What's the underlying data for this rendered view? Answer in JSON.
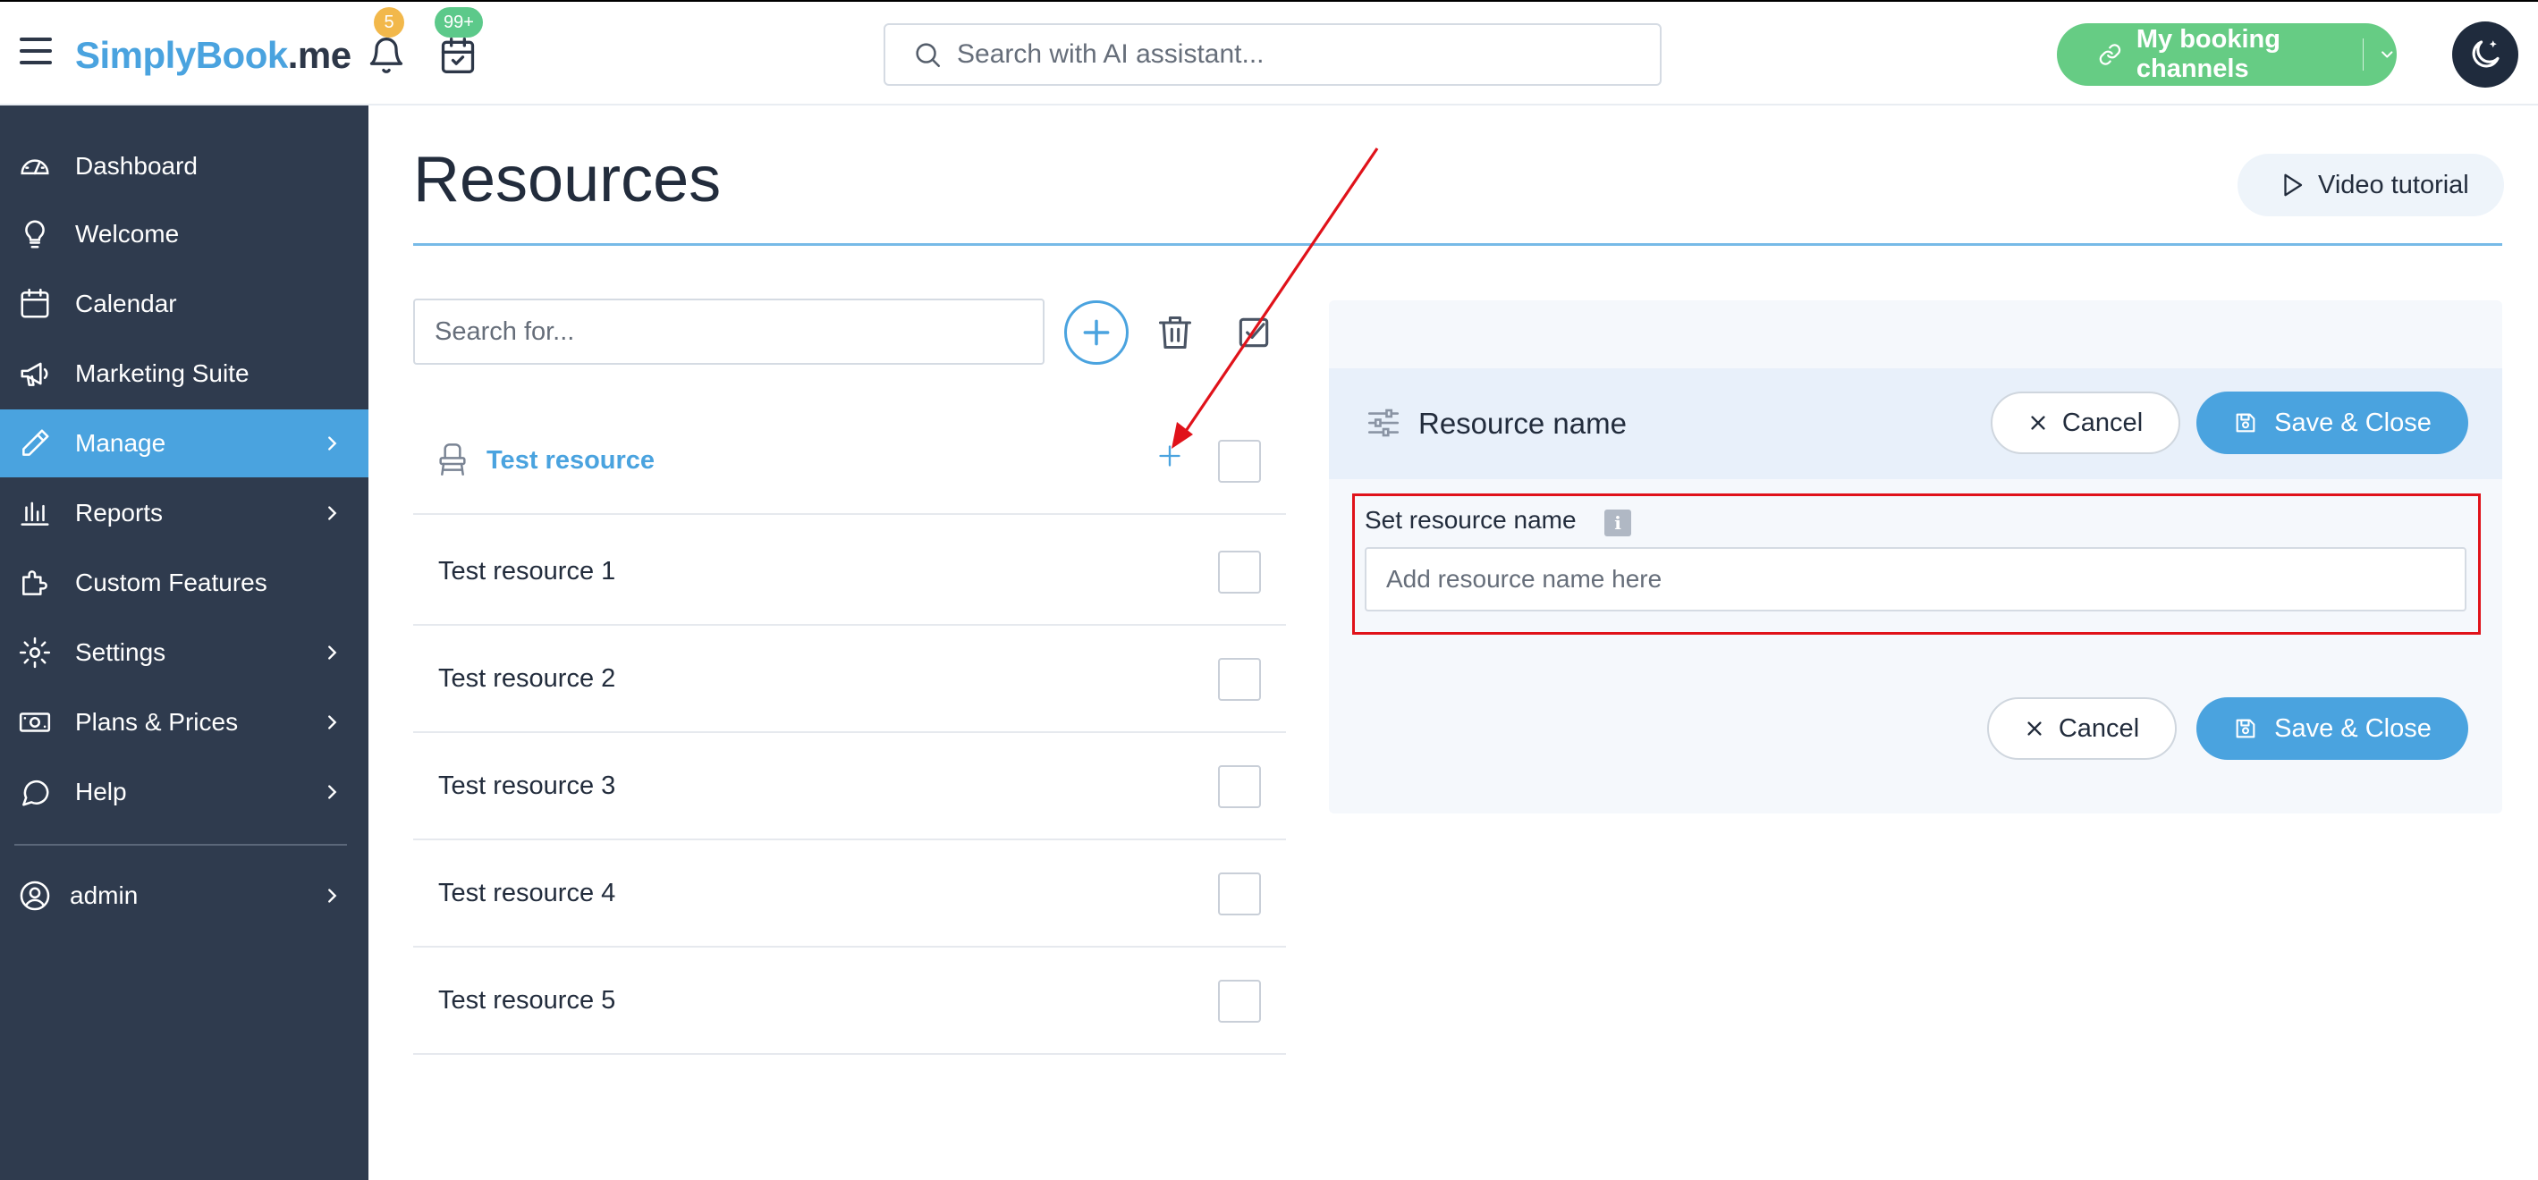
{
  "header": {
    "logo_part1": "SimplyBook",
    "logo_part2": ".me",
    "notifications_badge": "5",
    "bookings_badge": "99+",
    "search_placeholder": "Search with AI assistant...",
    "booking_channels_label": "My booking channels"
  },
  "sidebar": {
    "items": [
      {
        "label": "Dashboard",
        "icon": "gauge-icon"
      },
      {
        "label": "Welcome",
        "icon": "lightbulb-icon"
      },
      {
        "label": "Calendar",
        "icon": "calendar-icon"
      },
      {
        "label": "Marketing Suite",
        "icon": "megaphone-icon"
      },
      {
        "label": "Manage",
        "icon": "pencil-icon",
        "active": true
      },
      {
        "label": "Reports",
        "icon": "bar-chart-icon"
      },
      {
        "label": "Custom Features",
        "icon": "puzzle-icon"
      },
      {
        "label": "Settings",
        "icon": "gear-icon"
      },
      {
        "label": "Plans & Prices",
        "icon": "money-icon"
      },
      {
        "label": "Help",
        "icon": "chat-bubble-icon"
      }
    ],
    "user_label": "admin"
  },
  "main": {
    "title": "Resources",
    "video_tutorial_label": "Video tutorial",
    "search_placeholder": "Search for...",
    "resources": [
      {
        "name": "Test resource"
      },
      {
        "name": "Test resource 1"
      },
      {
        "name": "Test resource 2"
      },
      {
        "name": "Test resource 3"
      },
      {
        "name": "Test resource 4"
      },
      {
        "name": "Test resource 5"
      }
    ]
  },
  "panel": {
    "title": "Resource name",
    "cancel_label": "Cancel",
    "save_label": "Save & Close",
    "field_label": "Set resource name",
    "field_placeholder": "Add resource name here",
    "info_glyph": "i"
  },
  "colors": {
    "accent": "#4aa3df",
    "sidebar_bg": "#2f3b4e",
    "channels_green": "#66cc84",
    "annotation_red": "#e0121a"
  }
}
